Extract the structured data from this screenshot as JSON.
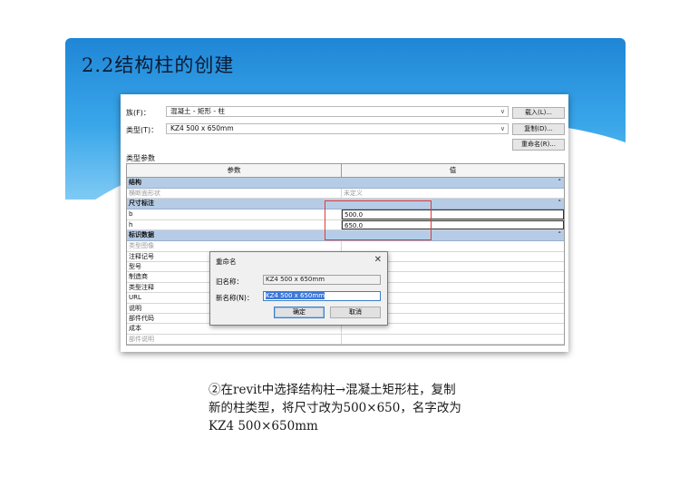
{
  "slide": {
    "title": "2.2结构柱的创建",
    "caption_lines": [
      "②在revit中选择结构柱→混凝土矩形柱，复制",
      "新的柱类型，将尺寸改为500×650，名字改为",
      "KZ4 500×650mm"
    ]
  },
  "type_properties": {
    "family_label": "族(F)：",
    "family_value": "混凝土 - 矩形 - 柱",
    "type_label": "类型(T)：",
    "type_value": "KZ4 500 x 650mm",
    "load_button": "载入(L)...",
    "duplicate_button": "复制(D)...",
    "rename_button": "重命名(R)...",
    "section_label": "类型参数",
    "columns": [
      "参数",
      "值"
    ],
    "groups": [
      {
        "name": "结构",
        "rows": [
          {
            "param": "横断面形状",
            "value": "未定义",
            "grey": true
          }
        ]
      },
      {
        "name": "尺寸标注",
        "rows": [
          {
            "param": "b",
            "value": "500.0",
            "grey": false
          },
          {
            "param": "h",
            "value": "650.0",
            "grey": false
          }
        ]
      },
      {
        "name": "标识数据",
        "rows": [
          {
            "param": "类型图像",
            "value": "",
            "grey": true
          },
          {
            "param": "注释记号",
            "value": "",
            "grey": false
          },
          {
            "param": "型号",
            "value": "",
            "grey": false
          },
          {
            "param": "制造商",
            "value": "",
            "grey": false
          },
          {
            "param": "类型注释",
            "value": "",
            "grey": false
          },
          {
            "param": "URL",
            "value": "",
            "grey": false
          },
          {
            "param": "说明",
            "value": "",
            "grey": false
          },
          {
            "param": "部件代码",
            "value": "",
            "grey": false
          },
          {
            "param": "成本",
            "value": "",
            "grey": false
          },
          {
            "param": "部件说明",
            "value": "",
            "grey": true
          }
        ]
      }
    ]
  },
  "rename_dialog": {
    "title": "重命名",
    "old_name_label": "旧名称：",
    "old_name_value": "KZ4 500 x 650mm",
    "new_name_label": "新名称(N)：",
    "new_name_value": "KZ4 500 x 650mm",
    "ok_button": "确定",
    "cancel_button": "取消"
  },
  "colors": {
    "banner": "#2a97e0",
    "group_header": "#b6cce6",
    "highlight_box": "#e03a3a",
    "selection": "#3c78d8"
  }
}
